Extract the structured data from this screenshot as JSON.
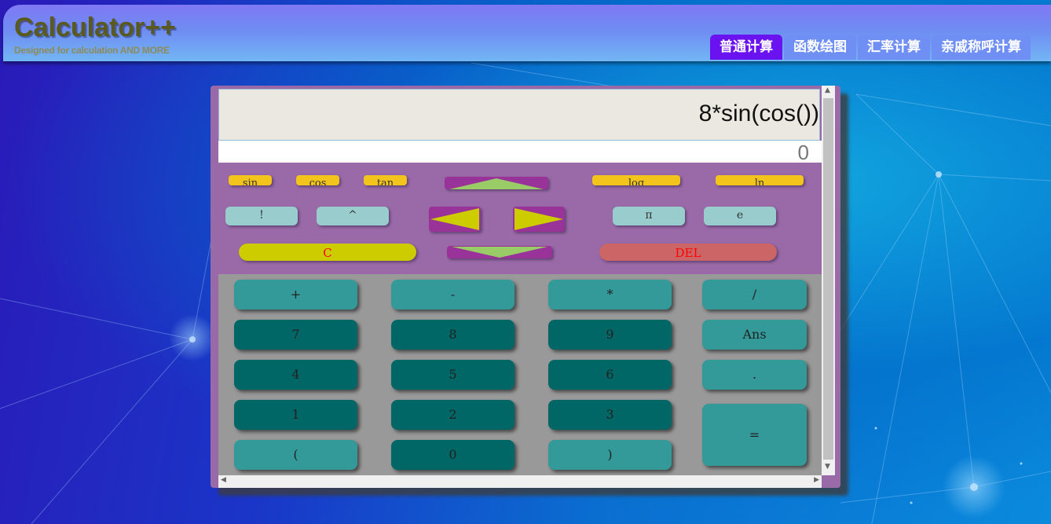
{
  "header": {
    "logo": "Calculator++",
    "tagline": "Designed for calculation AND MORE",
    "tabs": [
      {
        "label": "普通计算",
        "active": true
      },
      {
        "label": "函数绘图",
        "active": false
      },
      {
        "label": "汇率计算",
        "active": false
      },
      {
        "label": "亲戚称呼计算",
        "active": false
      }
    ]
  },
  "display": {
    "expression": "8*sin(cos())",
    "result": "0"
  },
  "scientific": {
    "functions": [
      "sin",
      "cos",
      "tan",
      "log",
      "ln"
    ],
    "factorial": "!",
    "power": "^",
    "pi": "π",
    "e": "e",
    "clear": "C",
    "delete": "DEL"
  },
  "keypad": {
    "add": "+",
    "subtract": "-",
    "multiply": "*",
    "divide": "/",
    "seven": "7",
    "eight": "8",
    "nine": "9",
    "ans": "Ans",
    "four": "4",
    "five": "5",
    "six": "6",
    "dot": ".",
    "one": "1",
    "two": "2",
    "three": "3",
    "equals": "=",
    "lparen": "(",
    "zero": "0",
    "rparen": ")"
  },
  "colors": {
    "active_tab": "#6a12f0",
    "panel": "#9a6aa8",
    "function_key": "#f3c41c",
    "digit_key": "#006666",
    "operator_key": "#339999",
    "clear_key": "#cccc00",
    "delete_key": "#cc6666"
  }
}
